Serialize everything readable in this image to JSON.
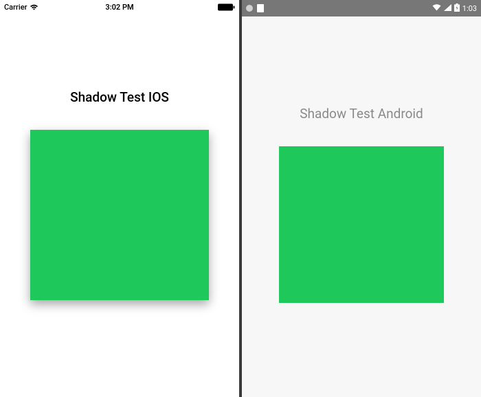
{
  "ios": {
    "status": {
      "carrier": "Carrier",
      "time": "3:02 PM"
    },
    "title": "Shadow Test IOS",
    "box_color": "#1ec85b"
  },
  "android": {
    "status": {
      "time": "1:03"
    },
    "title": "Shadow Test Android",
    "box_color": "#1ec85b"
  }
}
